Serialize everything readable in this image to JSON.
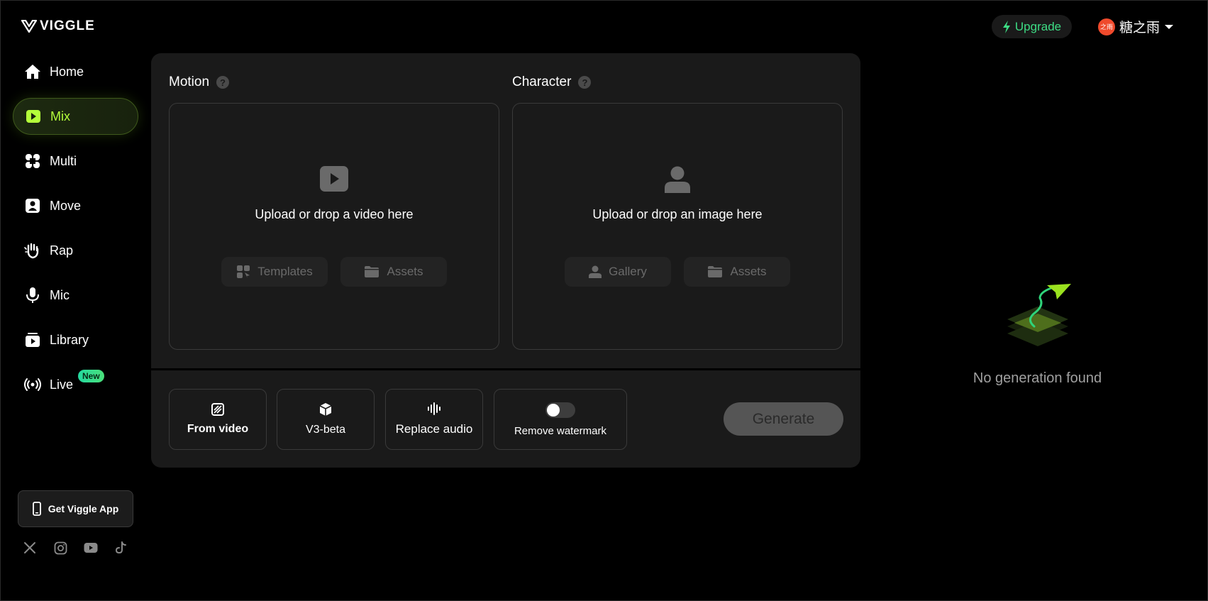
{
  "brand": {
    "name": "VIGGLE"
  },
  "header": {
    "upgrade_label": "Upgrade",
    "user": {
      "avatar_text": "之雨",
      "name": "糖之雨"
    }
  },
  "sidebar": {
    "items": [
      {
        "label": "Home",
        "icon": "home-icon"
      },
      {
        "label": "Mix",
        "icon": "play-square-icon",
        "active": true
      },
      {
        "label": "Multi",
        "icon": "multi-icon"
      },
      {
        "label": "Move",
        "icon": "person-square-icon"
      },
      {
        "label": "Rap",
        "icon": "hand-icon"
      },
      {
        "label": "Mic",
        "icon": "mic-icon"
      },
      {
        "label": "Library",
        "icon": "library-icon"
      },
      {
        "label": "Live",
        "icon": "broadcast-icon",
        "badge": "New"
      }
    ],
    "get_app_label": "Get Viggle App",
    "socials": [
      "x-icon",
      "instagram-icon",
      "youtube-icon",
      "tiktok-icon"
    ]
  },
  "motion": {
    "title": "Motion",
    "help": "?",
    "upload_text": "Upload or drop a video here",
    "buttons": [
      {
        "label": "Templates",
        "icon": "templates-icon"
      },
      {
        "label": "Assets",
        "icon": "folder-icon"
      }
    ]
  },
  "character": {
    "title": "Character",
    "help": "?",
    "upload_text": "Upload or drop an image here",
    "buttons": [
      {
        "label": "Gallery",
        "icon": "person-icon"
      },
      {
        "label": "Assets",
        "icon": "folder-icon"
      }
    ]
  },
  "options": [
    {
      "label": "From video",
      "icon": "hatch-square-icon"
    },
    {
      "label": "V3-beta",
      "icon": "cube-icon"
    },
    {
      "label": "Replace audio",
      "icon": "waveform-icon"
    },
    {
      "label": "Remove watermark",
      "toggle": false
    }
  ],
  "generate_label": "Generate",
  "empty_state": {
    "text": "No generation found"
  },
  "colors": {
    "accent": "#b4ff3a",
    "upgrade": "#3ddc84",
    "panel": "#1a1a1a",
    "background": "#000000"
  }
}
